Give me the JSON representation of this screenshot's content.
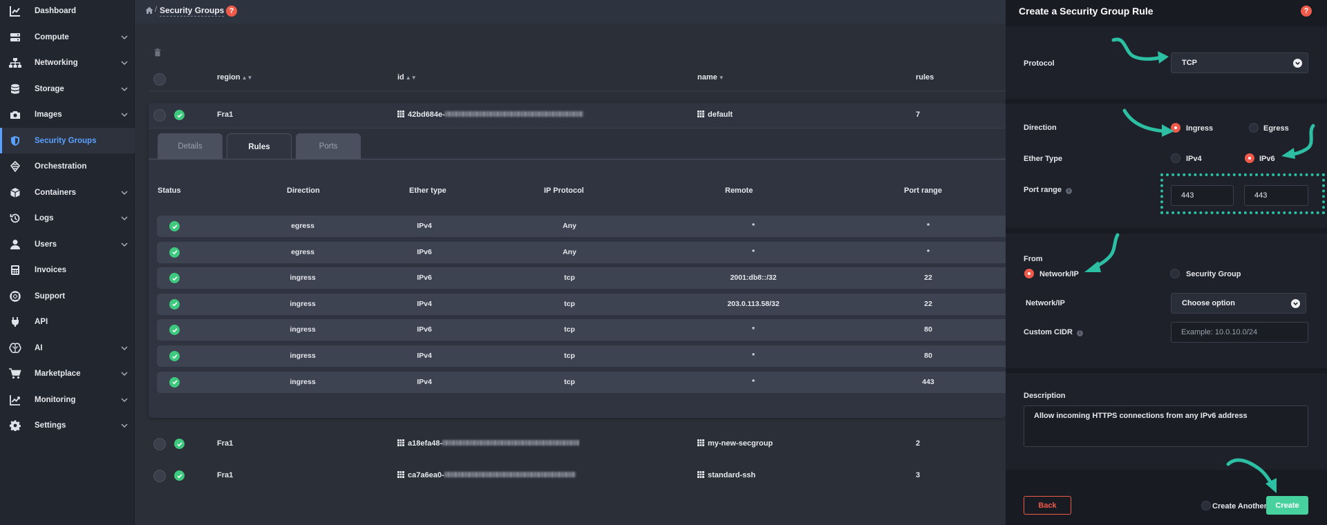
{
  "sidebar": {
    "items": [
      {
        "label": "Dashboard",
        "icon": "chart-icon",
        "has_chevron": false,
        "active": false
      },
      {
        "label": "Compute",
        "icon": "server-icon",
        "has_chevron": true,
        "active": false
      },
      {
        "label": "Networking",
        "icon": "network-icon",
        "has_chevron": true,
        "active": false
      },
      {
        "label": "Storage",
        "icon": "database-icon",
        "has_chevron": true,
        "active": false
      },
      {
        "label": "Images",
        "icon": "camera-icon",
        "has_chevron": true,
        "active": false
      },
      {
        "label": "Security Groups",
        "icon": "shield-icon",
        "has_chevron": false,
        "active": true
      },
      {
        "label": "Orchestration",
        "icon": "orchestration-icon",
        "has_chevron": false,
        "active": false
      },
      {
        "label": "Containers",
        "icon": "cube-icon",
        "has_chevron": true,
        "active": false
      },
      {
        "label": "Logs",
        "icon": "history-icon",
        "has_chevron": true,
        "active": false
      },
      {
        "label": "Users",
        "icon": "user-icon",
        "has_chevron": true,
        "active": false
      },
      {
        "label": "Invoices",
        "icon": "calculator-icon",
        "has_chevron": false,
        "active": false
      },
      {
        "label": "Support",
        "icon": "lifebuoy-icon",
        "has_chevron": false,
        "active": false
      },
      {
        "label": "API",
        "icon": "plug-icon",
        "has_chevron": false,
        "active": false
      },
      {
        "label": "AI",
        "icon": "brain-icon",
        "has_chevron": true,
        "active": false
      },
      {
        "label": "Marketplace",
        "icon": "cart-icon",
        "has_chevron": true,
        "active": false
      },
      {
        "label": "Monitoring",
        "icon": "trend-icon",
        "has_chevron": true,
        "active": false
      },
      {
        "label": "Settings",
        "icon": "gear-icon",
        "has_chevron": true,
        "active": false
      }
    ]
  },
  "topbar": {
    "breadcrumb_sep": "/",
    "current": "Security Groups",
    "help": "?"
  },
  "table": {
    "columns": {
      "region": "region",
      "id": "id",
      "name": "name",
      "rules": "rules"
    },
    "rows": [
      {
        "region": "Fra1",
        "id_prefix": "42bd684e-",
        "name": "default",
        "rules": "7"
      },
      {
        "region": "Fra1",
        "id_prefix": "a18efa48-",
        "name": "my-new-secgroup",
        "rules": "2"
      },
      {
        "region": "Fra1",
        "id_prefix": "ca7a6ea0-",
        "name": "standard-ssh",
        "rules": "3"
      }
    ]
  },
  "tabs": [
    "Details",
    "Rules",
    "Ports"
  ],
  "rules_table": {
    "headers": {
      "status": "Status",
      "direction": "Direction",
      "ether": "Ether type",
      "proto": "IP Protocol",
      "remote": "Remote",
      "port": "Port range"
    },
    "rows": [
      {
        "direction": "egress",
        "ether": "IPv4",
        "proto": "Any",
        "remote": "*",
        "port": "*"
      },
      {
        "direction": "egress",
        "ether": "IPv6",
        "proto": "Any",
        "remote": "*",
        "port": "*"
      },
      {
        "direction": "ingress",
        "ether": "IPv6",
        "proto": "tcp",
        "remote": "2001:db8::/32",
        "port": "22"
      },
      {
        "direction": "ingress",
        "ether": "IPv4",
        "proto": "tcp",
        "remote": "203.0.113.58/32",
        "port": "22"
      },
      {
        "direction": "ingress",
        "ether": "IPv6",
        "proto": "tcp",
        "remote": "*",
        "port": "80"
      },
      {
        "direction": "ingress",
        "ether": "IPv4",
        "proto": "tcp",
        "remote": "*",
        "port": "80"
      },
      {
        "direction": "ingress",
        "ether": "IPv4",
        "proto": "tcp",
        "remote": "*",
        "port": "443"
      }
    ]
  },
  "drawer": {
    "title": "Create a Security Group Rule",
    "help": "?",
    "protocol_label": "Protocol",
    "protocol_value": "TCP",
    "direction_label": "Direction",
    "ingress_label": "Ingress",
    "egress_label": "Egress",
    "ether_label": "Ether Type",
    "ipv4_label": "IPv4",
    "ipv6_label": "IPv6",
    "port_range_label": "Port range",
    "port_min": "443",
    "port_max": "443",
    "from_label": "From",
    "network_ip_label": "Network/IP",
    "security_group_label": "Security Group",
    "network_field_label": "Network/IP",
    "network_select_value": "Choose option",
    "cidr_label": "Custom CIDR",
    "cidr_placeholder": "Example: 10.0.10.0/24",
    "description_label": "Description",
    "description_value": "Allow incoming HTTPS connections from any IPv6 address",
    "back_label": "Back",
    "create_another_label": "Create Another",
    "create_label": "Create"
  },
  "colors": {
    "accent": "#f05a4a",
    "primary_blue": "#5aa1ff",
    "success": "#3ec97f",
    "create_button": "#47d19e",
    "annotation": "#2cbfa3"
  }
}
